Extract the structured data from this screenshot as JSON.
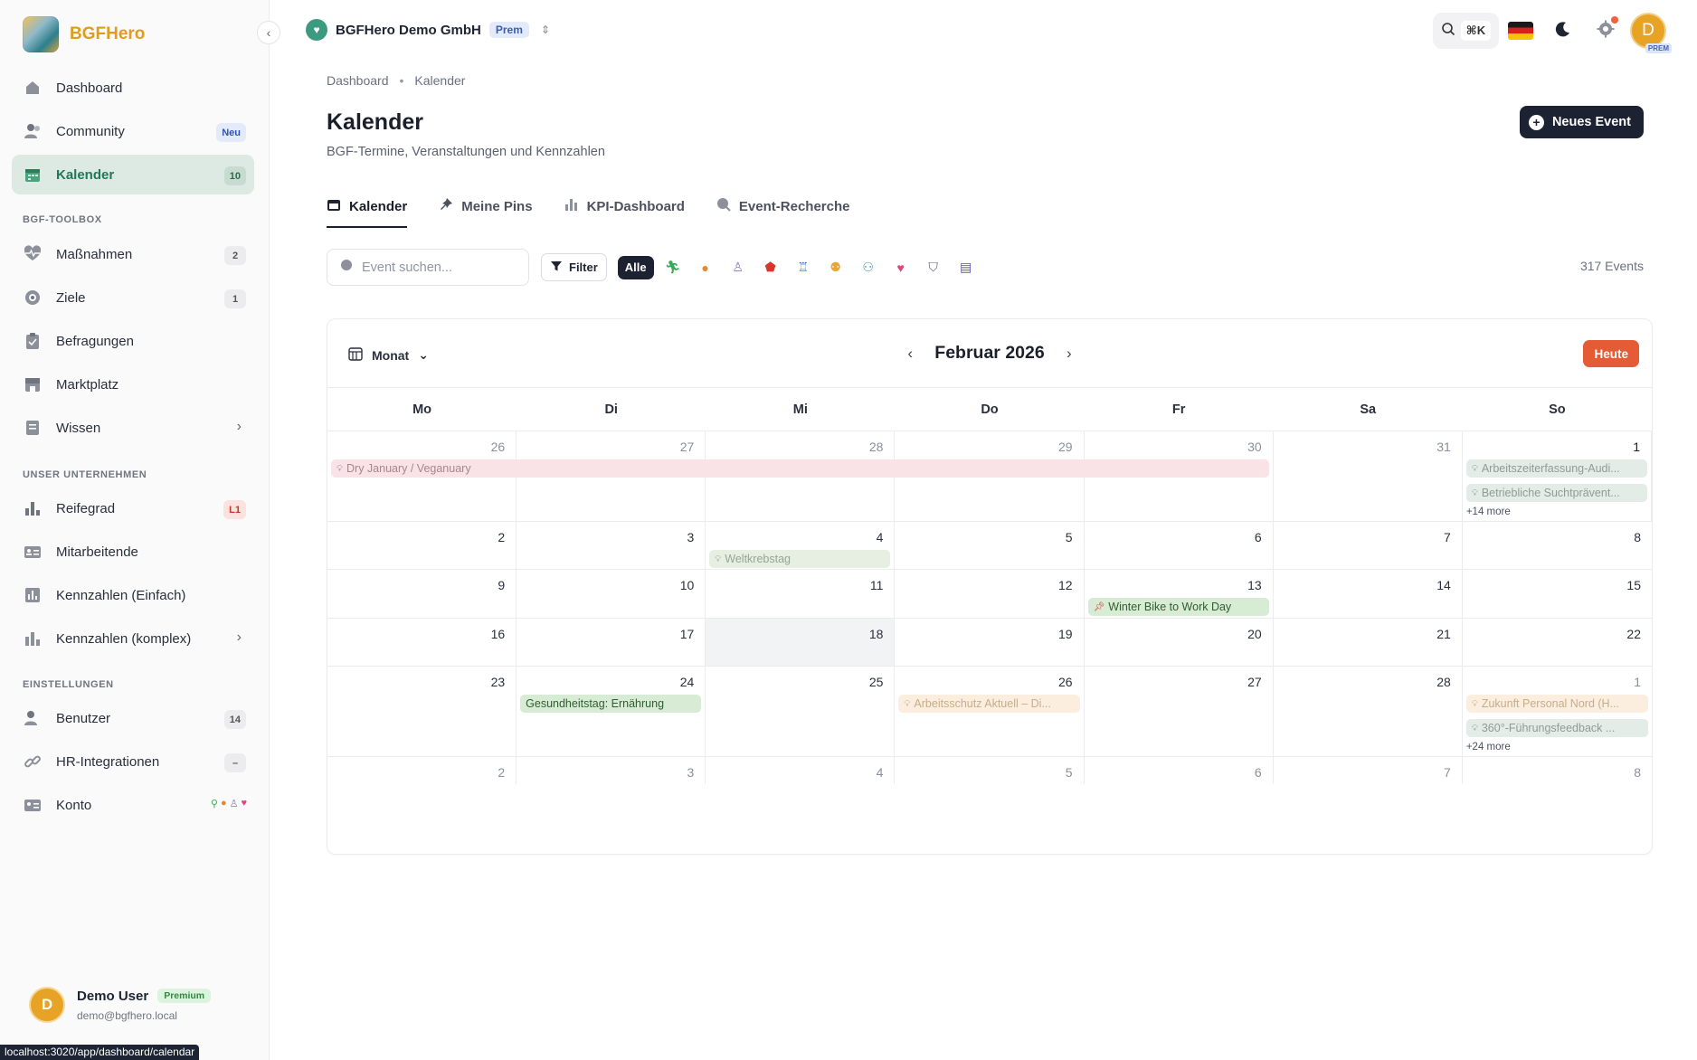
{
  "brand": {
    "name": "BGFHero"
  },
  "sidebar": {
    "items": [
      {
        "label": "Dashboard",
        "icon": "home-icon"
      },
      {
        "label": "Community",
        "icon": "users-icon",
        "badge": "Neu"
      },
      {
        "label": "Kalender",
        "icon": "calendar-icon",
        "badge": "10"
      }
    ],
    "sections": [
      {
        "label": "BGF-TOOLBOX",
        "items": [
          {
            "label": "Maßnahmen",
            "badge": "2"
          },
          {
            "label": "Ziele",
            "badge": "1"
          },
          {
            "label": "Befragungen"
          },
          {
            "label": "Marktplatz"
          },
          {
            "label": "Wissen"
          }
        ]
      },
      {
        "label": "UNSER UNTERNEHMEN",
        "items": [
          {
            "label": "Reifegrad",
            "badge": "L1"
          },
          {
            "label": "Mitarbeitende"
          },
          {
            "label": "Kennzahlen (Einfach)"
          },
          {
            "label": "Kennzahlen (komplex)"
          }
        ]
      },
      {
        "label": "EINSTELLUNGEN",
        "items": [
          {
            "label": "Benutzer",
            "badge": "14"
          },
          {
            "label": "HR-Integrationen",
            "badge": "–"
          },
          {
            "label": "Konto"
          }
        ]
      }
    ]
  },
  "user": {
    "initial": "D",
    "name": "Demo User",
    "plan": "Premium",
    "email": "demo@bgfhero.local"
  },
  "status_url": "localhost:3020/app/dashboard/calendar",
  "topbar": {
    "org_name": "BGFHero Demo GmbH",
    "org_plan": "Prem",
    "shortcut": "⌘K",
    "avatar_initial": "D",
    "avatar_tag": "PREM"
  },
  "breadcrumb": {
    "home": "Dashboard",
    "sep": "•",
    "current": "Kalender"
  },
  "page": {
    "title": "Kalender",
    "subtitle": "BGF-Termine, Veranstaltungen und Kennzahlen",
    "new_event": "Neues Event"
  },
  "tabs": [
    {
      "label": "Kalender"
    },
    {
      "label": "Meine Pins"
    },
    {
      "label": "KPI-Dashboard"
    },
    {
      "label": "Event-Recherche"
    }
  ],
  "filter": {
    "search_placeholder": "Event suchen...",
    "filter_label": "Filter",
    "all_label": "Alle",
    "event_count": "317 Events"
  },
  "calendar": {
    "view": "Monat",
    "month_title": "Februar 2026",
    "today_label": "Heute",
    "weekdays": [
      "Mo",
      "Di",
      "Mi",
      "Do",
      "Fr",
      "Sa",
      "So"
    ],
    "weeks": [
      [
        "26",
        "27",
        "28",
        "29",
        "30",
        "31",
        "1"
      ],
      [
        "2",
        "3",
        "4",
        "5",
        "6",
        "7",
        "8"
      ],
      [
        "9",
        "10",
        "11",
        "12",
        "13",
        "14",
        "15"
      ],
      [
        "16",
        "17",
        "18",
        "19",
        "20",
        "21",
        "22"
      ],
      [
        "23",
        "24",
        "25",
        "26",
        "27",
        "28",
        "1"
      ],
      [
        "2",
        "3",
        "4",
        "5",
        "6",
        "7",
        "8"
      ]
    ],
    "events": {
      "dry_january": "Dry January / Veganuary",
      "arbeitszeit": "Arbeitszeiterfassung-Audi...",
      "sucht": "Betriebliche Suchtprävent...",
      "more_w1": "+14 more",
      "weltkrebstag": "Weltkrebstag",
      "winter_bike": "Winter Bike to Work Day",
      "gesundheitstag": "Gesundheitstag: Ernährung",
      "arbeitsschutz": "Arbeitsschutz Aktuell – Di...",
      "zukunft": "Zukunft Personal Nord (H...",
      "feedback": "360°-Führungsfeedback ...",
      "more_w5": "+24 more"
    }
  },
  "colors": {
    "accent": "#1f7a56",
    "brand": "#e19c1b",
    "today_button": "#e55b35",
    "primary_button": "#1d2233"
  }
}
